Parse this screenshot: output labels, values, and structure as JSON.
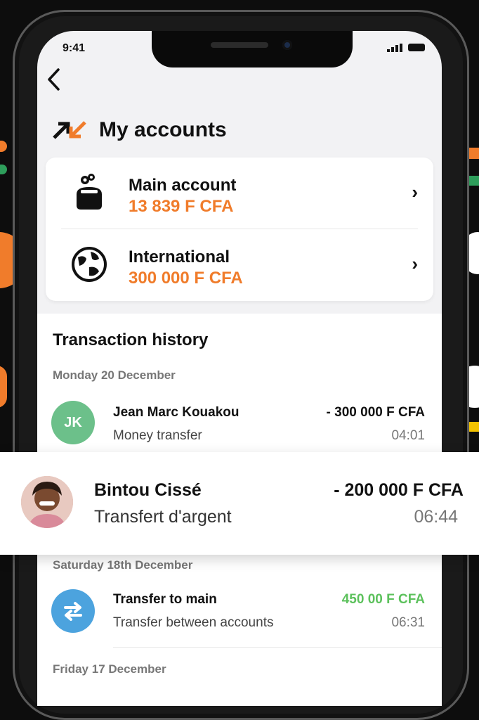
{
  "status_bar": {
    "time": "9:41"
  },
  "header": {
    "title": "My accounts",
    "back_icon": "chevron-left-icon",
    "title_icon": "transfer-arrows-icon"
  },
  "accounts": [
    {
      "name": "Main account",
      "amount": "13 839 F CFA",
      "icon": "wallet-icon"
    },
    {
      "name": "International",
      "amount": "300 000 F CFA",
      "icon": "globe-icon"
    }
  ],
  "history": {
    "title": "Transaction history",
    "groups": [
      {
        "date": "Monday 20 December",
        "transactions": [
          {
            "initials": "JK",
            "name": "Jean Marc Kouakou",
            "description": "Money transfer",
            "amount": "- 300 000 F CFA",
            "time": "04:01"
          }
        ]
      },
      {
        "date": "Saturday 18th December",
        "transactions": [
          {
            "name": "Transfer to main",
            "description": "Transfer between accounts",
            "amount": "450 00 F CFA",
            "time": "06:31"
          }
        ]
      },
      {
        "date": "Friday 17 December",
        "transactions": []
      }
    ]
  },
  "highlight": {
    "name": "Bintou Cissé",
    "description": "Transfert d'argent",
    "amount": "- 200 000 F CFA",
    "time": "06:44"
  },
  "colors": {
    "accent_orange": "#f07c2b",
    "credit_green": "#5cc15c",
    "avatar_green": "#6cc08a",
    "transfer_blue": "#4ca3de"
  }
}
